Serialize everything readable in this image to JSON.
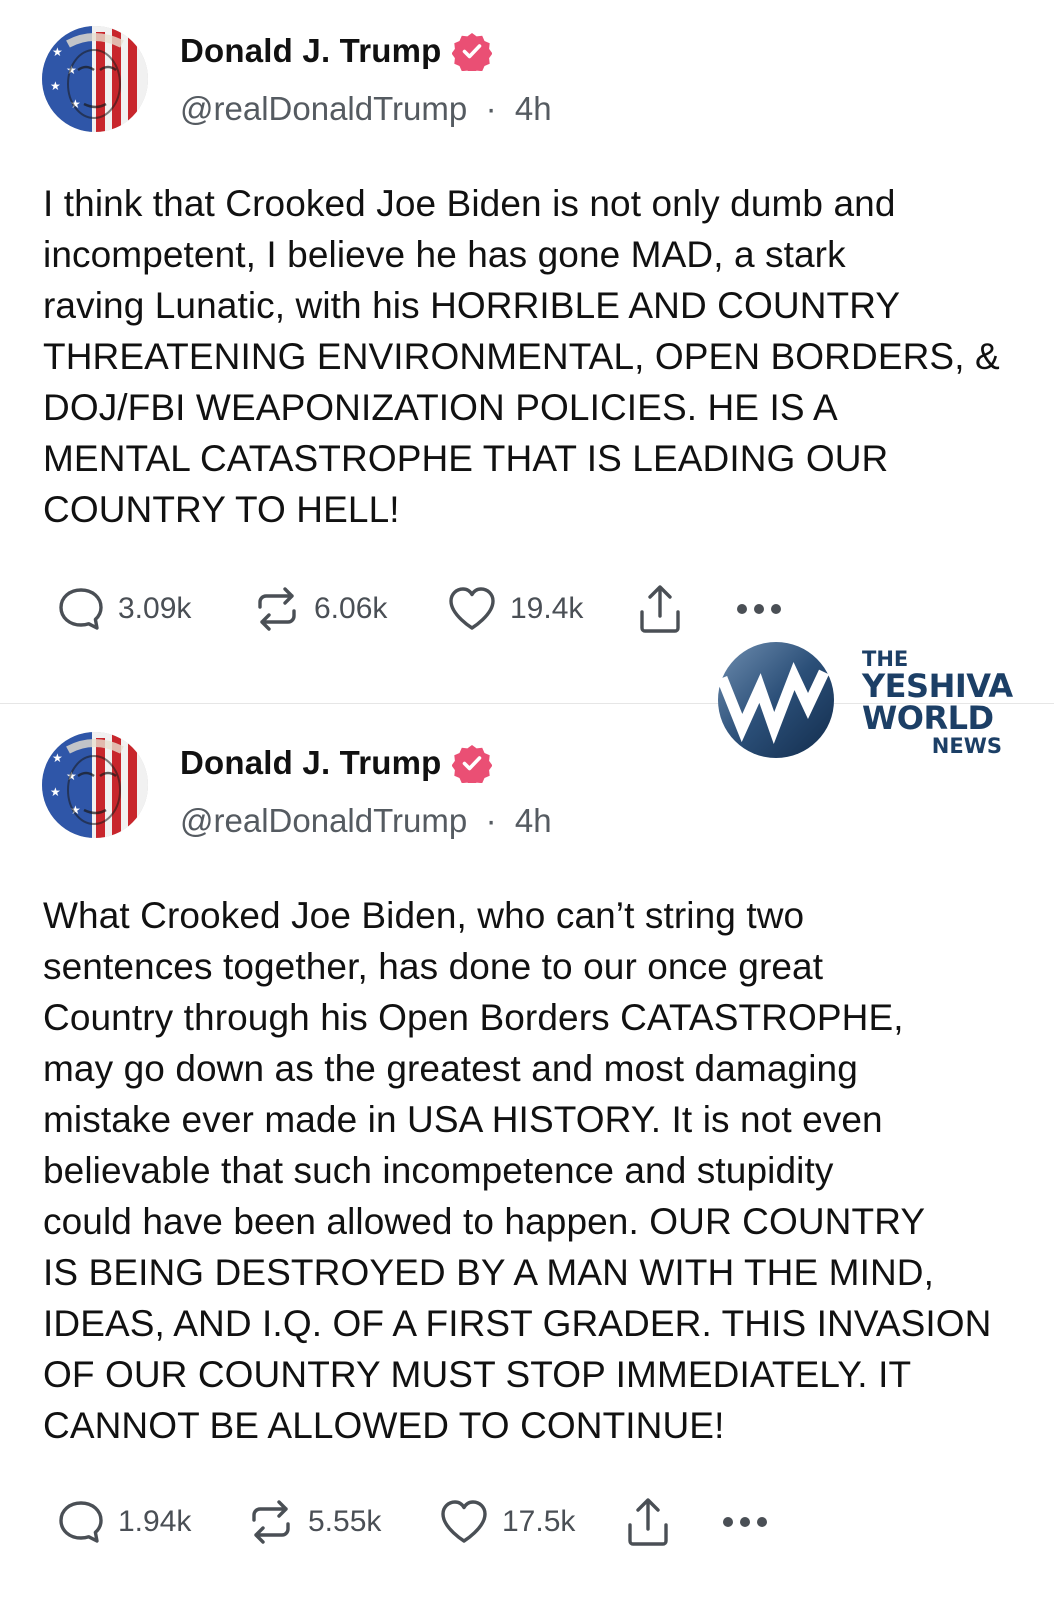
{
  "posts": [
    {
      "author": {
        "display_name": "Donald J. Trump",
        "verified": true,
        "handle": "@realDonaldTrump",
        "separator": "·",
        "time": "4h"
      },
      "text_lines": [
        "I think that Crooked Joe Biden is not only dumb and",
        "incompetent, I believe he has gone MAD, a stark",
        "raving Lunatic, with his HORRIBLE AND COUNTRY",
        "THREATENING ENVIRONMENTAL, OPEN BORDERS, &",
        "DOJ/FBI WEAPONIZATION POLICIES. HE IS A",
        "MENTAL CATASTROPHE THAT IS LEADING OUR",
        "COUNTRY TO HELL!"
      ],
      "stats": {
        "replies": "3.09k",
        "reposts": "6.06k",
        "likes": "19.4k"
      }
    },
    {
      "author": {
        "display_name": "Donald J. Trump",
        "verified": true,
        "handle": "@realDonaldTrump",
        "separator": "·",
        "time": "4h"
      },
      "text_lines": [
        "What Crooked Joe Biden, who can’t string two",
        "sentences together, has done to our once great",
        "Country through his Open Borders CATASTROPHE,",
        "may go down as the greatest and most damaging",
        "mistake ever made in USA HISTORY. It is not even",
        "believable that such incompetence and stupidity",
        "could have been allowed to happen. OUR COUNTRY",
        "IS BEING DESTROYED BY A MAN WITH THE MIND,",
        "IDEAS, AND I.Q. OF A FIRST GRADER. THIS INVASION",
        "OF OUR COUNTRY MUST STOP IMMEDIATELY. IT",
        "CANNOT BE ALLOWED TO CONTINUE!"
      ],
      "stats": {
        "replies": "1.94k",
        "reposts": "5.55k",
        "likes": "17.5k"
      }
    }
  ],
  "watermark": {
    "the": "THE",
    "yeshiva": "YESHIVA",
    "world": "WORLD",
    "news": "NEWS"
  },
  "icons": {
    "reply": "reply-bubble-icon",
    "repost": "repost-arrows-icon",
    "like": "heart-icon",
    "share": "share-upload-icon",
    "more": "more-dots-icon",
    "verified": "verified-badge-icon"
  },
  "colors": {
    "verified_badge": "#ea4f74",
    "text": "#111111",
    "secondary_text": "#555b61",
    "icon": "#4a4f55",
    "divider": "#e6e6e6",
    "logo_blue": "#1c3f66"
  }
}
